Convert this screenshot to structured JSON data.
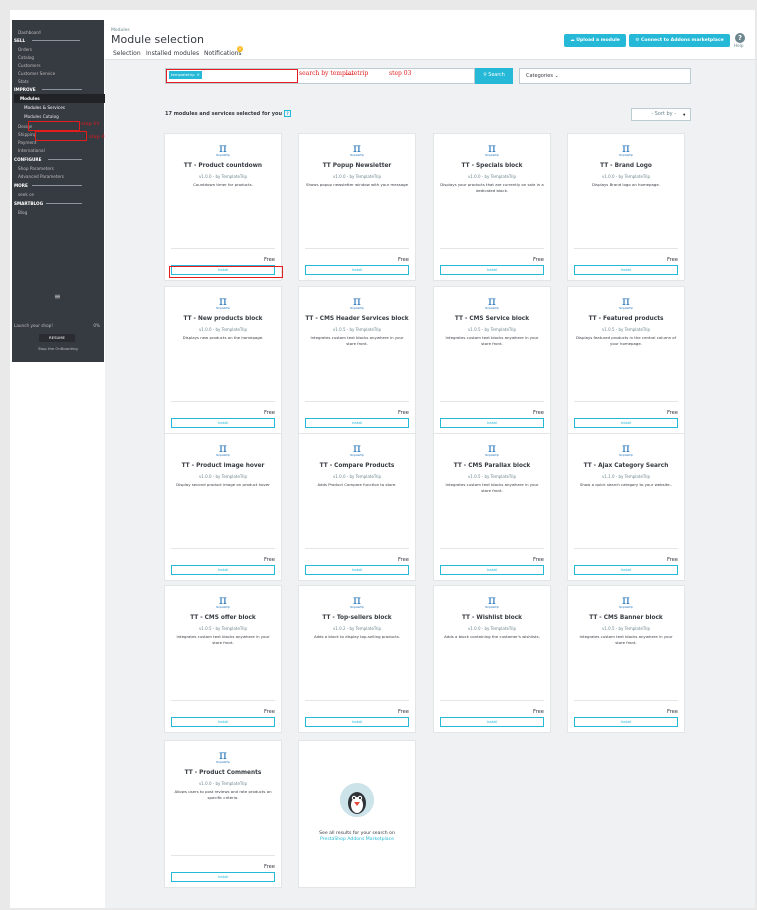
{
  "sidebar": {
    "dashboard": "Dashboard",
    "sec_sell": "SELL",
    "orders": "Orders",
    "catalog": "Catalog",
    "customers": "Customers",
    "customer_service": "Customer Service",
    "stats": "Stats",
    "sec_improve": "IMPROVE",
    "modules": "Modules",
    "modules_services": "Modules & Services",
    "modules_catalog": "Modules Catalog",
    "design": "Design",
    "shipping": "Shipping",
    "payment": "Payment",
    "international": "International",
    "sec_configure": "CONFIGURE",
    "shop_parameters": "Shop Parameters",
    "advanced_parameters": "Advanced Parameters",
    "sec_more": "MORE",
    "seek": "seek ce",
    "sec_smartblog": "SMARTBLOG",
    "blog": "Blog",
    "launch_text": "Launch your shop!",
    "launch_pct": "0%",
    "resume": "RESUME",
    "stop_onboarding": "Stop the OnBoarding"
  },
  "annotations": {
    "step01": "step 01",
    "step02": "step 02",
    "step03": "step 03",
    "search_by": "search by templatetrip"
  },
  "header": {
    "breadcrumb": "Modules",
    "title": "Module selection",
    "tab_selection": "Selection",
    "tab_installed": "Installed modules",
    "tab_notifications": "Notifications",
    "notif_count": "0",
    "upload_btn": "Upload a module",
    "connect_btn": "Connect to Addons marketplace",
    "help": "Help"
  },
  "search": {
    "tag": "templatetrip",
    "button": "Search",
    "categories": "Categories"
  },
  "list": {
    "count_text": "17 modules and services selected for you",
    "sort": "- Sort by -"
  },
  "modules": [
    {
      "title": "TT - Product countdown",
      "version": "v1.0.0 - by TemplateTrip",
      "desc": "Countdown timer for products.",
      "price": "Free",
      "install": "Install"
    },
    {
      "title": "TT Popup Newsletter",
      "version": "v1.0.0 - by TemplateTrip",
      "desc": "Shows popup newsletter window with your message",
      "price": "Free",
      "install": "Install"
    },
    {
      "title": "TT - Specials block",
      "version": "v1.0.0 - by TemplateTrip",
      "desc": "Displays your products that are currently on sale in a dedicated block.",
      "price": "Free",
      "install": "Install"
    },
    {
      "title": "TT - Brand Logo",
      "version": "v1.0.0 - by TemplateTrip",
      "desc": "Displays Brand logo on homepage.",
      "price": "Free",
      "install": "Install"
    },
    {
      "title": "TT - New products block",
      "version": "v1.0.0 - by TemplateTrip",
      "desc": "Displays new products on the homepage.",
      "price": "Free",
      "install": "Install"
    },
    {
      "title": "TT - CMS Header Services block",
      "version": "v1.0.5 - by TemplateTrip",
      "desc": "Integrates custom text blocks anywhere in your store front.",
      "price": "Free",
      "install": "Install"
    },
    {
      "title": "TT - CMS Service block",
      "version": "v1.0.5 - by TemplateTrip",
      "desc": "Integrates custom text blocks anywhere in your store front.",
      "price": "Free",
      "install": "Install"
    },
    {
      "title": "TT - Featured products",
      "version": "v1.0.5 - by TemplateTrip",
      "desc": "Displays featured products in the central column of your homepage.",
      "price": "Free",
      "install": "Install"
    },
    {
      "title": "TT - Product image hover",
      "version": "v1.0.0 - by TemplateTrip",
      "desc": "Display second product image on product hover",
      "price": "Free",
      "install": "Install"
    },
    {
      "title": "TT - Compare Products",
      "version": "v1.0.0 - by TemplateTrip",
      "desc": "Adds Product Compare function to store.",
      "price": "Free",
      "install": "Install"
    },
    {
      "title": "TT - CMS Parallax block",
      "version": "v1.0.5 - by TemplateTrip",
      "desc": "Integrates custom text blocks anywhere in your store front.",
      "price": "Free",
      "install": "Install"
    },
    {
      "title": "TT - Ajax Category Search",
      "version": "v1.1.0 - by TemplateTrip",
      "desc": "Show a quick search category to your website..",
      "price": "Free",
      "install": "Install"
    },
    {
      "title": "TT - CMS offer block",
      "version": "v1.0.5 - by TemplateTrip",
      "desc": "Integrates custom text blocks anywhere in your store front.",
      "price": "Free",
      "install": "Install"
    },
    {
      "title": "TT - Top-sellers block",
      "version": "v1.0.2 - by TemplateTrip",
      "desc": "Adds a block to display top-selling products.",
      "price": "Free",
      "install": "Install"
    },
    {
      "title": "TT - Wishlist block",
      "version": "v1.0.0 - by TemplateTrip",
      "desc": "Adds a block containing the customer's wishlists.",
      "price": "Free",
      "install": "Install"
    },
    {
      "title": "TT - CMS Banner block",
      "version": "v1.0.5 - by TemplateTrip",
      "desc": "Integrates custom text blocks anywhere in your store front.",
      "price": "Free",
      "install": "Install"
    },
    {
      "title": "TT - Product Comments",
      "version": "v1.0.0 - by TemplateTrip",
      "desc": "Allows users to post reviews and rate products on specific criteria.",
      "price": "Free",
      "install": "Install"
    }
  ],
  "addons_card": {
    "line1": "See all results for your search on",
    "link": "PrestaShop Addons Marketplace"
  },
  "colors": {
    "accent": "#25b9d7",
    "sidebar": "#363a41",
    "annotation": "#e11d1d",
    "logo": "#1d6fb5"
  },
  "icons": {
    "upload": "cloud-upload-icon",
    "connect": "key-icon",
    "help": "question-icon",
    "search": "search-icon",
    "module_logo": "templatetrip-pi-logo",
    "addons": "prestashop-puffin-logo"
  }
}
